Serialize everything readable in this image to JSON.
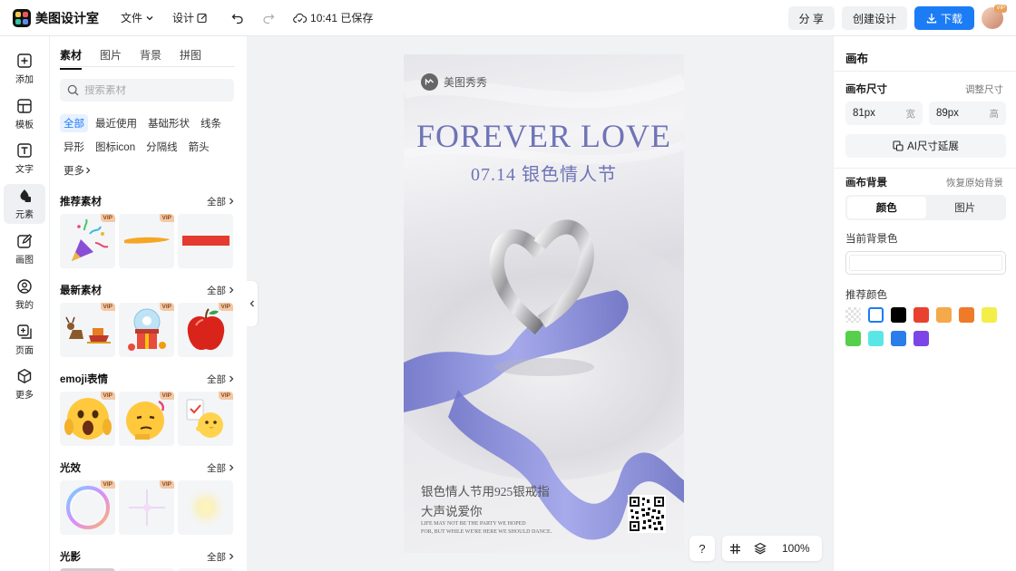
{
  "app": {
    "name": "美图设计室"
  },
  "toolbar": {
    "file_label": "文件",
    "design_label": "设计",
    "save_status": "10:41 已保存",
    "share_label": "分 享",
    "create_label": "创建设计",
    "download_label": "下载"
  },
  "user": {
    "badge": "VIP"
  },
  "leftnav": [
    {
      "label": "添加",
      "icon": "plus-square-icon"
    },
    {
      "label": "模板",
      "icon": "template-icon"
    },
    {
      "label": "文字",
      "icon": "text-icon"
    },
    {
      "label": "元素",
      "icon": "shapes-icon"
    },
    {
      "label": "画图",
      "icon": "pen-icon"
    },
    {
      "label": "我的",
      "icon": "user-icon"
    },
    {
      "label": "页面",
      "icon": "page-add-icon"
    },
    {
      "label": "更多",
      "icon": "cube-icon"
    }
  ],
  "panel": {
    "tabs": [
      "素材",
      "图片",
      "背景",
      "拼图"
    ],
    "search_placeholder": "搜索素材",
    "chips": [
      "全部",
      "最近使用",
      "基础形状",
      "线条",
      "异形",
      "图标icon",
      "分隔线",
      "箭头",
      "更多"
    ],
    "all_label": "全部",
    "vip_label": "VIP",
    "sections": [
      {
        "title": "推荐素材"
      },
      {
        "title": "最新素材"
      },
      {
        "title": "emoji表情"
      },
      {
        "title": "光效"
      },
      {
        "title": "光影"
      }
    ]
  },
  "poster": {
    "brand": "美图秀秀",
    "title": "FOREVER LOVE",
    "subtitle": "07.14  银色情人节",
    "line1": "银色情人节用925银戒指",
    "line2": "大声说爱你",
    "small1": "LIFE MAY NOT BE THE PARTY WE HOPED",
    "small2": "FOR, BUT WHILE WE'RE HERE WE SHOULD DANCE."
  },
  "canvas_tools": {
    "help": "?",
    "zoom": "100%"
  },
  "right": {
    "title": "画布",
    "size_label": "画布尺寸",
    "adjust_label": "调整尺寸",
    "width_value": "81px",
    "width_unit": "宽",
    "height_value": "89px",
    "height_unit": "高",
    "ai_btn": "AI尺寸延展",
    "bg_label": "画布背景",
    "restore_label": "恢复原始背景",
    "seg_color": "颜色",
    "seg_image": "图片",
    "current_bg_label": "当前背景色",
    "recommend_label": "推荐颜色",
    "swatches": [
      "transparent",
      "#ffffff",
      "#000000",
      "#e8412f",
      "#f4a94a",
      "#ef7a2a",
      "#f4ee48",
      "#56d04b",
      "#5ae6e6",
      "#2b7de9",
      "#7c45e6"
    ]
  }
}
